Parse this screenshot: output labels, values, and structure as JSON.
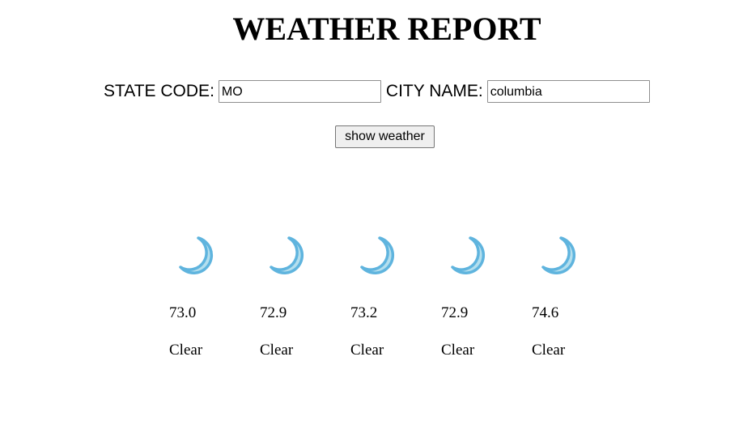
{
  "header": {
    "title": "WEATHER REPORT"
  },
  "form": {
    "state_label": "STATE CODE:",
    "state_value": "MO",
    "city_label": "CITY NAME:",
    "city_value": "columbia",
    "button_label": "show weather"
  },
  "forecast": [
    {
      "icon": "crescent-moon-icon",
      "temp": "73.0",
      "condition": "Clear"
    },
    {
      "icon": "crescent-moon-icon",
      "temp": "72.9",
      "condition": "Clear"
    },
    {
      "icon": "crescent-moon-icon",
      "temp": "73.2",
      "condition": "Clear"
    },
    {
      "icon": "crescent-moon-icon",
      "temp": "72.9",
      "condition": "Clear"
    },
    {
      "icon": "crescent-moon-icon",
      "temp": "74.6",
      "condition": "Clear"
    }
  ],
  "colors": {
    "moon_fill": "#b4dfee",
    "moon_stroke": "#5fb4de"
  }
}
